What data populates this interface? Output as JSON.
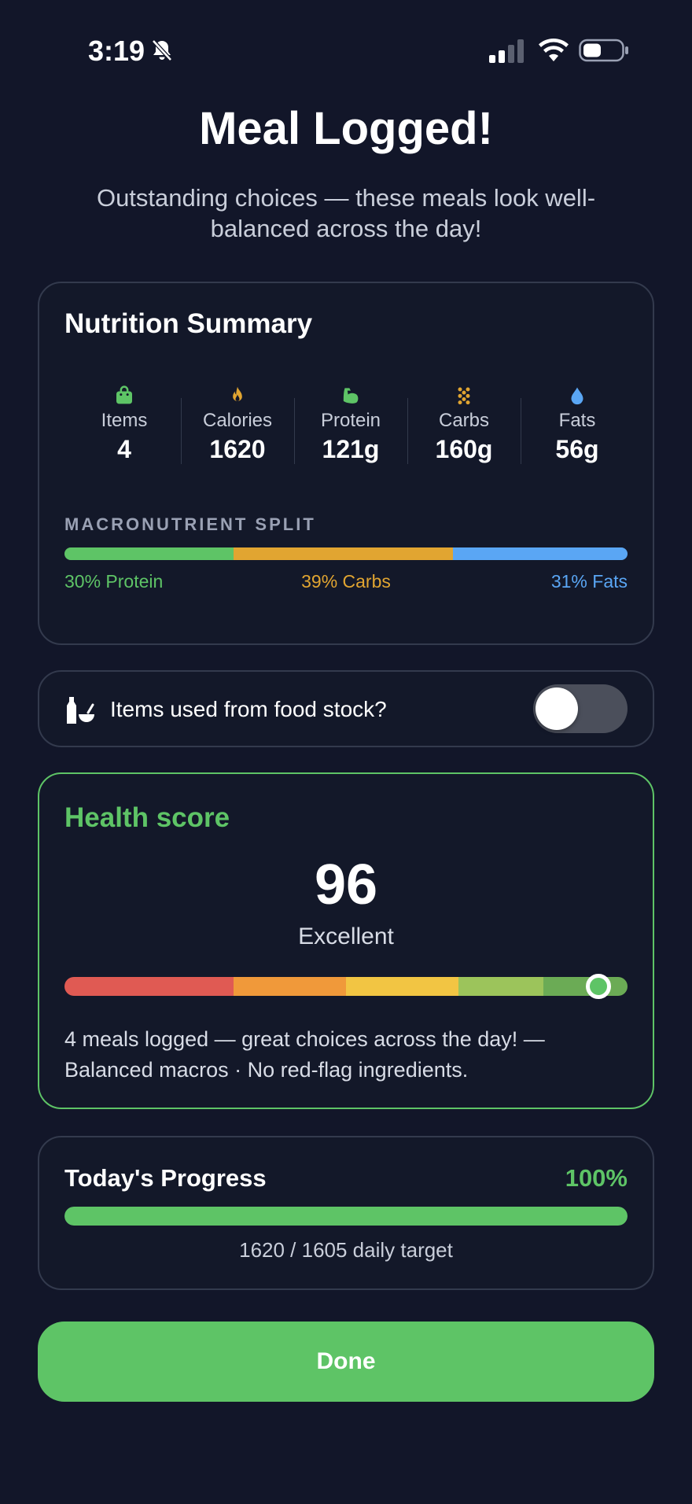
{
  "status_bar": {
    "time": "3:19",
    "icons": [
      "bell-slash-icon",
      "cellular-signal-icon",
      "wifi-icon",
      "battery-icon"
    ]
  },
  "header": {
    "title": "Meal Logged!",
    "subtitle": "Outstanding choices — these meals look well-balanced across the day!"
  },
  "nutrition": {
    "title": "Nutrition Summary",
    "stats": [
      {
        "label": "Items",
        "value": "4",
        "icon": "bag-icon",
        "color": "#5ec466"
      },
      {
        "label": "Calories",
        "value": "1620",
        "icon": "flame-icon",
        "color": "#e1a531"
      },
      {
        "label": "Protein",
        "value": "121g",
        "icon": "muscle-icon",
        "color": "#5ec466"
      },
      {
        "label": "Carbs",
        "value": "160g",
        "icon": "grain-icon",
        "color": "#e1a531"
      },
      {
        "label": "Fats",
        "value": "56g",
        "icon": "drop-icon",
        "color": "#5aa6f4"
      }
    ],
    "macro_heading": "MACRONUTRIENT SPLIT",
    "macros": [
      {
        "label": "30% Protein",
        "percent": 30,
        "color": "#5ec466"
      },
      {
        "label": "39% Carbs",
        "percent": 39,
        "color": "#e1a531"
      },
      {
        "label": "31% Fats",
        "percent": 31,
        "color": "#5aa6f4"
      }
    ]
  },
  "food_stock": {
    "label": "Items used from food stock?",
    "icon": "bottle-bowl-icon",
    "toggle_on": false
  },
  "health": {
    "title": "Health score",
    "score": "96",
    "rating": "Excellent",
    "score_fraction": 0.96,
    "segments": [
      {
        "color": "#e05a53",
        "share": 30
      },
      {
        "color": "#f0993a",
        "share": 20
      },
      {
        "color": "#f2c543",
        "share": 20
      },
      {
        "color": "#9cc45b",
        "share": 15
      },
      {
        "color": "#6bab55",
        "share": 15
      }
    ],
    "description": "4 meals logged — great choices across the day! — Balanced macros · No red-flag ingredients."
  },
  "progress": {
    "title": "Today's Progress",
    "percent_label": "100%",
    "fraction": 1.0,
    "target_text": "1620 / 1605 daily target"
  },
  "done_button": {
    "label": "Done"
  },
  "colors": {
    "background": "#121629",
    "accent_green": "#5ec466",
    "card_border": "#333a4d"
  }
}
